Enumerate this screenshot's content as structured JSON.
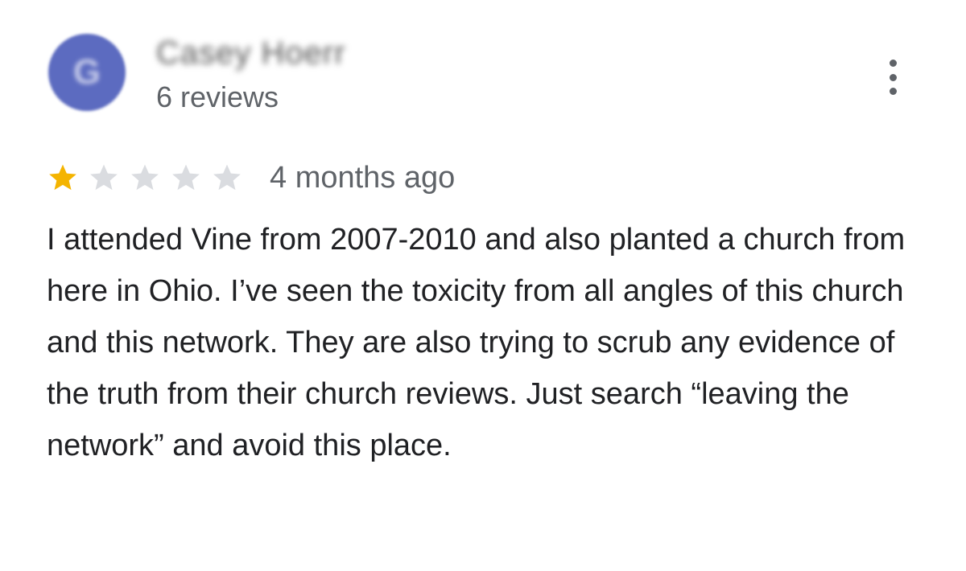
{
  "review": {
    "reviewer": {
      "avatar_letter": "G",
      "name": "Casey Hoerr",
      "review_count": "6 reviews"
    },
    "rating": {
      "value": 1,
      "max": 5,
      "filled_color": "#f4b400",
      "empty_color": "#dadce0"
    },
    "time": "4 months ago",
    "text": "I attended Vine from 2007-2010 and also planted a church from here in Ohio. I’ve seen the toxicity from all angles of this church and this network. They are also trying to scrub any evidence of the truth from their church reviews. Just search “leaving the network” and avoid this place.",
    "more_icon": "more-vert-icon"
  }
}
